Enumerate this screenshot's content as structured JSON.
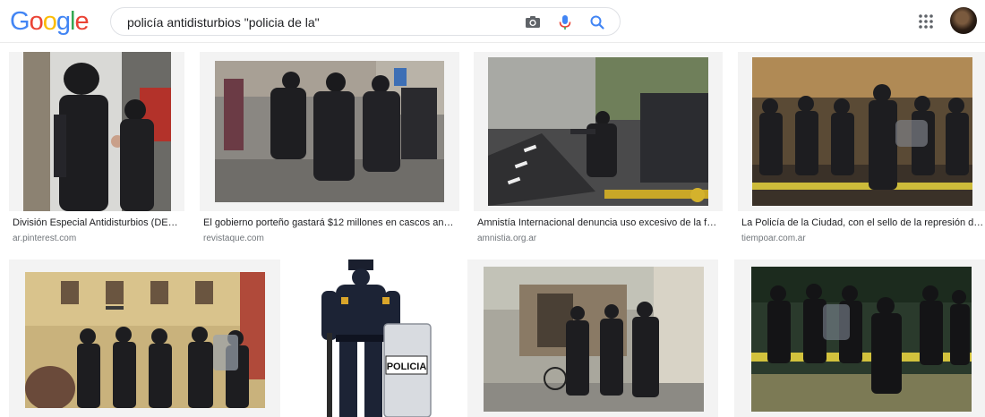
{
  "header": {
    "logo": [
      "G",
      "o",
      "o",
      "g",
      "l",
      "e"
    ],
    "logo_colors": [
      "#4285F4",
      "#EA4335",
      "#FBBC05",
      "#4285F4",
      "#34A853",
      "#EA4335"
    ],
    "search_value": "policía antidisturbios \"policia de la\"",
    "icons": {
      "camera": "camera-icon",
      "mic": "microphone-icon",
      "search": "search-icon",
      "apps": "apps-grid-icon"
    }
  },
  "results_row1": [
    {
      "caption": "División Especial Antidisturbios (DE…",
      "source": "ar.pinterest.com"
    },
    {
      "caption": "El gobierno porteño gastará $12 millones en cascos an…",
      "source": "revistaque.com"
    },
    {
      "caption": "Amnistía Internacional denuncia uso excesivo de la f…",
      "source": "amnistia.org.ar"
    },
    {
      "caption": "La Policía de la Ciudad, con el sello de la represión de…",
      "source": "tiempoar.com.ar"
    }
  ],
  "results_row2": [
    {
      "caption": "",
      "source": ""
    },
    {
      "caption": "",
      "source": "",
      "shield_text": "POLICIA"
    },
    {
      "caption": "",
      "source": ""
    },
    {
      "caption": "",
      "source": ""
    }
  ],
  "colors": {
    "link": "#202124",
    "source": "#70757a",
    "border": "#dfe1e5",
    "card_bg": "#f3f3f3"
  }
}
